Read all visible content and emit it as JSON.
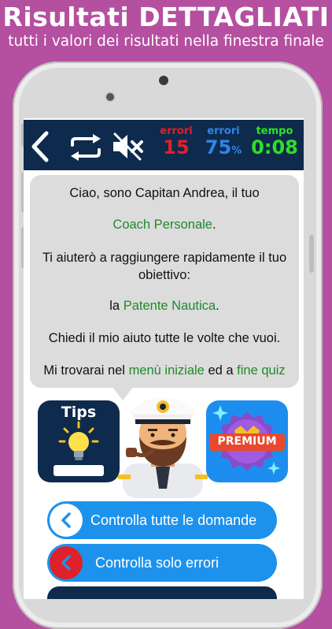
{
  "promo": {
    "title": "Risultati DETTAGLIATI",
    "subtitle": "tutti i valori dei risultati nella finestra finale"
  },
  "topbar": {
    "icons": [
      "back-icon",
      "repeat-icon",
      "mute-icon"
    ],
    "stats": {
      "errors_label": "errori",
      "errors_value": "15",
      "errors_color": "#e0202a",
      "percent_label": "errori",
      "percent_value": "75",
      "percent_unit": "%",
      "percent_color": "#2f86e8",
      "time_label": "tempo",
      "time_value": "0:08",
      "time_color": "#2ee026"
    }
  },
  "bubble": {
    "line1": "Ciao, sono Capitan Andrea, il tuo",
    "line2": "Coach Personale",
    "line2_suffix": ".",
    "line3": "Ti aiuterò a raggiungere rapidamente il tuo",
    "line4": "obiettivo:",
    "line5_prefix": "la ",
    "line5_highlight": "Patente Nautica",
    "line5_suffix": ".",
    "line6": "Chiedi il mio aiuto tutte le volte che vuoi.",
    "line7_prefix": "Mi trovarai nel ",
    "line7_highlight1": "menù iniziale",
    "line7_mid": " ed a ",
    "line7_highlight2": "fine quiz"
  },
  "tiles": {
    "tips_label": "Tips",
    "premium_label": "PREMIUM"
  },
  "actions": [
    {
      "label": "Controlla tutte le domande",
      "icon": "chevron-left-icon"
    },
    {
      "label": "Controlla solo errori",
      "icon": "chevron-left-icon"
    }
  ],
  "colors": {
    "background": "#b54fa0",
    "topbar": "#0e2a4d",
    "accent_green": "#1f8a2c",
    "button_blue": "#1d92ec",
    "error_red": "#e0202a"
  }
}
